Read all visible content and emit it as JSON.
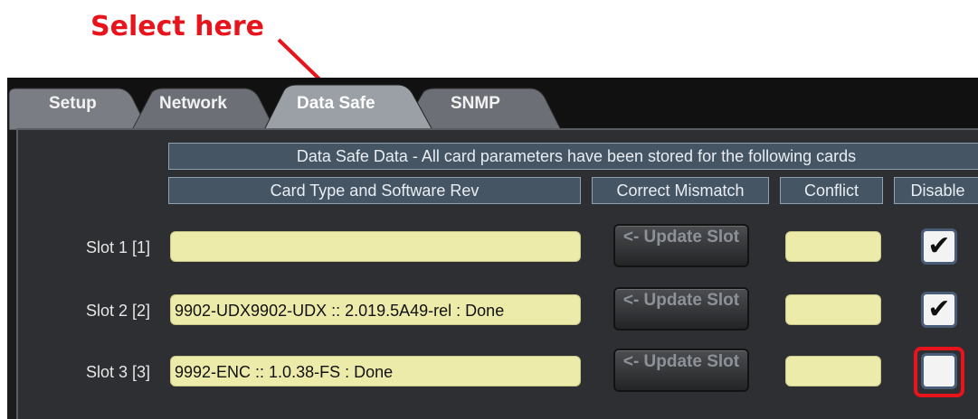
{
  "annotation": {
    "text": "Select here",
    "color": "#e8141c"
  },
  "tabs": [
    {
      "label": "Setup",
      "active": false
    },
    {
      "label": "Network",
      "active": false
    },
    {
      "label": "Data Safe",
      "active": true
    },
    {
      "label": "SNMP",
      "active": false
    }
  ],
  "panel": {
    "banner": "Data Safe Data - All card parameters have been stored for the following cards",
    "columns": {
      "card_type": "Card Type and Software Rev",
      "correct": "Correct Mismatch",
      "conflict": "Conflict",
      "disable": "Disable"
    },
    "update_label": "<- Update Slot",
    "slots": [
      {
        "label": "Slot 1 [1]",
        "card": "",
        "disabled": true,
        "check": "✔"
      },
      {
        "label": "Slot 2 [2]",
        "card": "9902-UDX9902-UDX :: 2.019.5A49-rel : Done",
        "disabled": true,
        "check": "✔"
      },
      {
        "label": "Slot 3 [3]",
        "card": "9992-ENC :: 1.0.38-FS : Done",
        "disabled": false,
        "check": ""
      }
    ]
  },
  "colors": {
    "field_yellow": "#ecebaa",
    "header_blue": "#465563",
    "highlight_red": "#e8141c"
  }
}
